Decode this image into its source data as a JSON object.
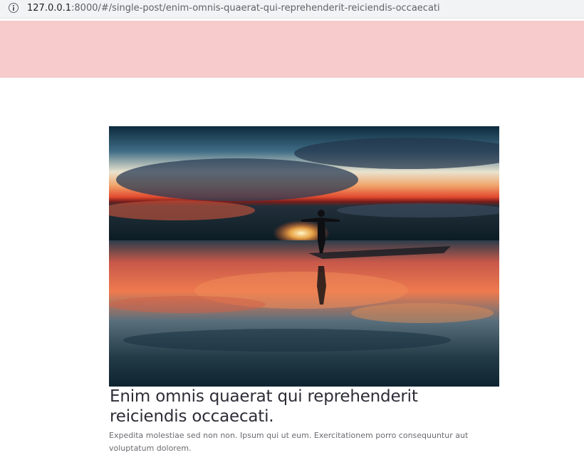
{
  "browser": {
    "info_icon": "info-icon",
    "url_host": "127.0.0.1",
    "url_rest": ":8000/#/single-post/enim-omnis-quaerat-qui-reprehenderit-reiciendis-occaecati"
  },
  "header": {
    "background_color": "#f7cacc"
  },
  "post": {
    "image_subject": "silhouette-at-sunset-over-water",
    "title": "Enim omnis quaerat qui reprehenderit reiciendis occaecati.",
    "excerpt": "Expedita molestiae sed non non. Ipsum qui ut eum. Exercitationem porro consequuntur aut voluptatum dolorem."
  }
}
